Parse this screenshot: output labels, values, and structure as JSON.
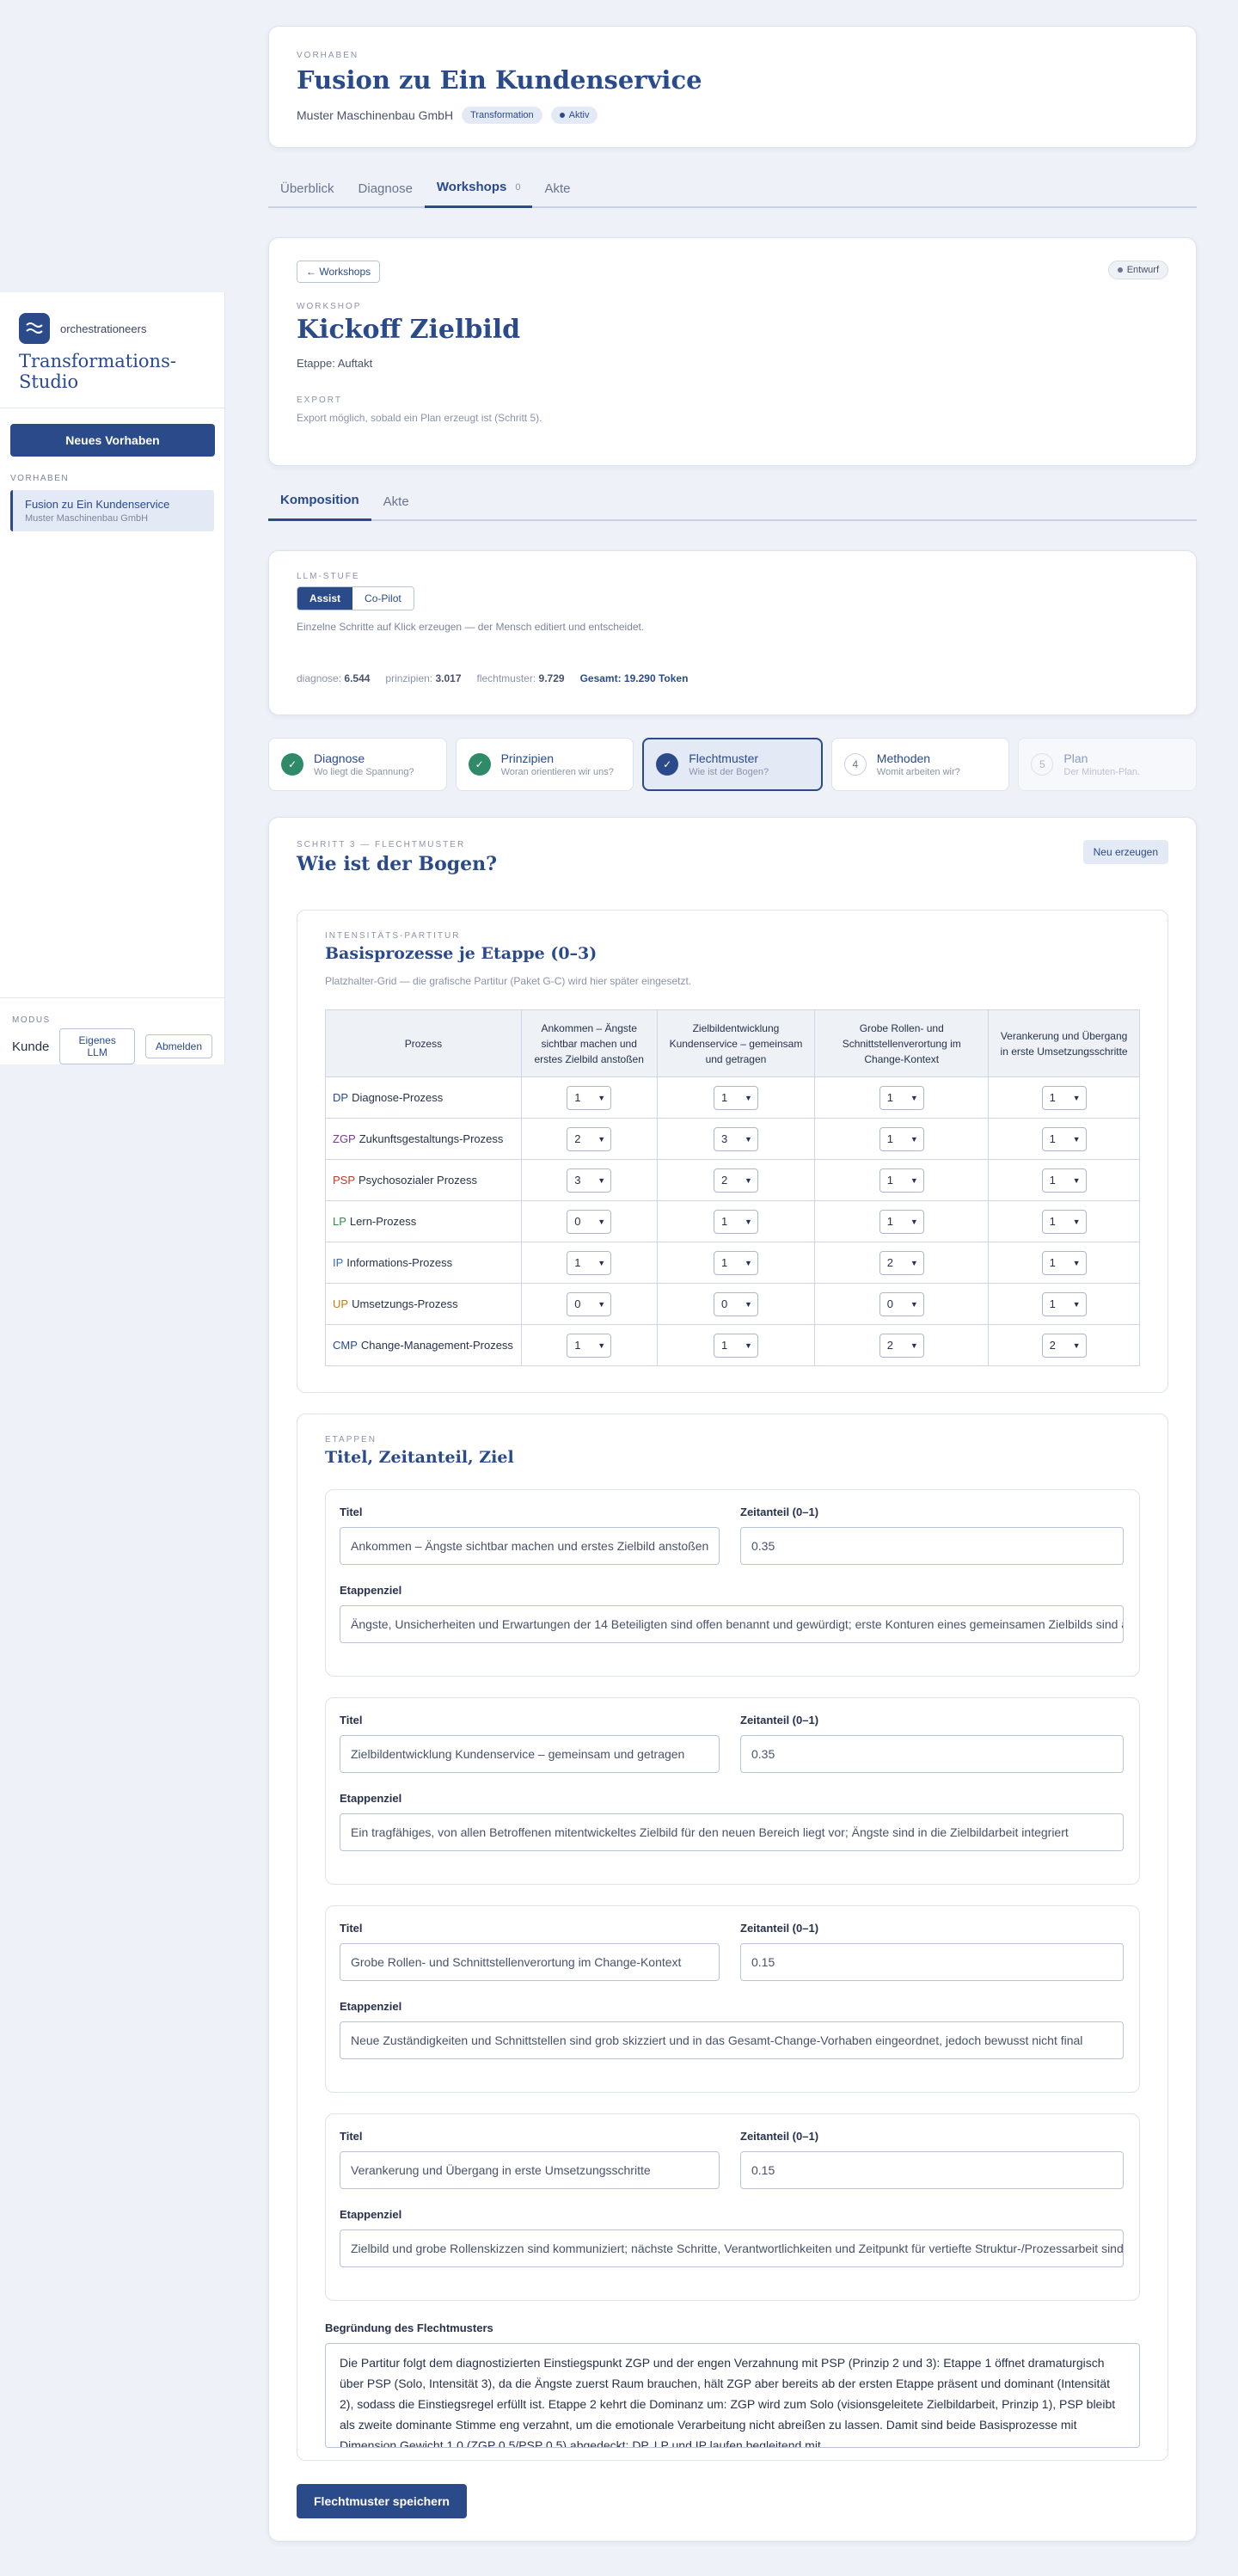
{
  "sidebar": {
    "brand": "orchestrationeers",
    "studio": "Transformations-Studio",
    "new_button": "Neues Vorhaben",
    "section_label": "VORHABEN",
    "project": {
      "title": "Fusion zu Ein Kundenservice",
      "subtitle": "Muster Maschinenbau GmbH"
    },
    "modus_label": "MODUS",
    "modus_value": "Kunde",
    "llm_button": "Eigenes LLM",
    "logout_button": "Abmelden"
  },
  "header": {
    "eyebrow": "VORHABEN",
    "title": "Fusion zu Ein Kundenservice",
    "company": "Muster Maschinenbau GmbH",
    "tag": "Transformation",
    "status": "Aktiv"
  },
  "main_tabs": [
    {
      "label": "Überblick"
    },
    {
      "label": "Diagnose"
    },
    {
      "label": "Workshops",
      "count": "0"
    },
    {
      "label": "Akte"
    }
  ],
  "workshop": {
    "back": "← Workshops",
    "status": "Entwurf",
    "eyebrow": "WORKSHOP",
    "title": "Kickoff Zielbild",
    "etappe": "Etappe: Auftakt",
    "export_label": "EXPORT",
    "export_text": "Export möglich, sobald ein Plan erzeugt ist (Schritt 5)."
  },
  "sub_tabs": [
    {
      "label": "Komposition"
    },
    {
      "label": "Akte"
    }
  ],
  "llm": {
    "eyebrow": "LLM-STUFE",
    "options": [
      "Assist",
      "Co-Pilot"
    ],
    "description": "Einzelne Schritte auf Klick erzeugen — der Mensch editiert und entscheidet.",
    "tokens": {
      "diagnose_label": "diagnose:",
      "diagnose": "6.544",
      "prinzipien_label": "prinzipien:",
      "prinzipien": "3.017",
      "flechtmuster_label": "flechtmuster:",
      "flechtmuster": "9.729",
      "total": "Gesamt: 19.290 Token"
    }
  },
  "steps": [
    {
      "icon": "✓",
      "title": "Diagnose",
      "sub": "Wo liegt die Spannung?"
    },
    {
      "icon": "✓",
      "title": "Prinzipien",
      "sub": "Woran orientieren wir uns?"
    },
    {
      "icon": "✓",
      "title": "Flechtmuster",
      "sub": "Wie ist der Bogen?"
    },
    {
      "icon": "4",
      "title": "Methoden",
      "sub": "Womit arbeiten wir?"
    },
    {
      "icon": "5",
      "title": "Plan",
      "sub": "Der Minuten-Plan."
    }
  ],
  "step3": {
    "eyebrow": "SCHRITT 3 — FLECHTMUSTER",
    "title": "Wie ist der Bogen?",
    "regen_button": "Neu erzeugen"
  },
  "partitur": {
    "eyebrow": "INTENSITÄTS-PARTITUR",
    "title": "Basisprozesse je Etappe (0–3)",
    "description": "Platzhalter-Grid — die grafische Partitur (Paket G-C) wird hier später eingesetzt.",
    "columns": [
      "Prozess",
      "Ankommen – Ängste sichtbar machen und erstes Zielbild anstoßen",
      "Zielbildentwicklung Kundenservice – gemeinsam und getragen",
      "Grobe Rollen- und Schnittstellenverortung im Change-Kontext",
      "Verankerung und Übergang in erste Umsetzungsschritte"
    ],
    "rows": [
      {
        "abbr": "DP",
        "color": "#2a4a8a",
        "name": "Diagnose-Prozess",
        "values": [
          "1",
          "1",
          "1",
          "1"
        ]
      },
      {
        "abbr": "ZGP",
        "color": "#7a3a8a",
        "name": "Zukunftsgestaltungs-Prozess",
        "values": [
          "2",
          "3",
          "1",
          "1"
        ]
      },
      {
        "abbr": "PSP",
        "color": "#c0392b",
        "name": "Psychosozialer Prozess",
        "values": [
          "3",
          "2",
          "1",
          "1"
        ]
      },
      {
        "abbr": "LP",
        "color": "#2f8a4a",
        "name": "Lern-Prozess",
        "values": [
          "0",
          "1",
          "1",
          "1"
        ]
      },
      {
        "abbr": "IP",
        "color": "#3a6ab0",
        "name": "Informations-Prozess",
        "values": [
          "1",
          "1",
          "2",
          "1"
        ]
      },
      {
        "abbr": "UP",
        "color": "#c07a1a",
        "name": "Umsetzungs-Prozess",
        "values": [
          "0",
          "0",
          "0",
          "1"
        ]
      },
      {
        "abbr": "CMP",
        "color": "#2a4a8a",
        "name": "Change-Management-Prozess",
        "values": [
          "1",
          "1",
          "2",
          "2"
        ]
      }
    ]
  },
  "etappen": {
    "eyebrow": "ETAPPEN",
    "title": "Titel, Zeitanteil, Ziel",
    "title_label": "Titel",
    "share_label": "Zeitanteil (0–1)",
    "goal_label": "Etappenziel",
    "items": [
      {
        "title": "Ankommen – Ängste sichtbar machen und erstes Zielbild anstoßen",
        "share": "0.35",
        "goal": "Ängste, Unsicherheiten und Erwartungen der 14 Beteiligten sind offen benannt und gewürdigt; erste Konturen eines gemeinsamen Zielbilds sind angestoßen"
      },
      {
        "title": "Zielbildentwicklung Kundenservice – gemeinsam und getragen",
        "share": "0.35",
        "goal": "Ein tragfähiges, von allen Betroffenen mitentwickeltes Zielbild für den neuen Bereich liegt vor; Ängste sind in die Zielbildarbeit integriert"
      },
      {
        "title": "Grobe Rollen- und Schnittstellenverortung im Change-Kontext",
        "share": "0.15",
        "goal": "Neue Zuständigkeiten und Schnittstellen sind grob skizziert und in das Gesamt-Change-Vorhaben eingeordnet, jedoch bewusst nicht final"
      },
      {
        "title": "Verankerung und Übergang in erste Umsetzungsschritte",
        "share": "0.15",
        "goal": "Zielbild und grobe Rollenskizzen sind kommuniziert; nächste Schritte, Verantwortlichkeiten und Zeitpunkt für vertiefte Struktur-/Prozessarbeit sind vereinbart"
      }
    ],
    "rationale_label": "Begründung des Flechtmusters",
    "rationale": "Die Partitur folgt dem diagnostizierten Einstiegspunkt ZGP und der engen Verzahnung mit PSP (Prinzip 2 und 3): Etappe 1 öffnet dramaturgisch über PSP (Solo, Intensität 3), da die Ängste zuerst Raum brauchen, hält ZGP aber bereits ab der ersten Etappe präsent und dominant (Intensität 2), sodass die Einstiegsregel erfüllt ist. Etappe 2 kehrt die Dominanz um: ZGP wird zum Solo (visionsgeleitete Zielbildarbeit, Prinzip 1), PSP bleibt als zweite dominante Stimme eng verzahnt, um die emotionale Verarbeitung nicht abreißen zu lassen. Damit sind beide Basisprozesse mit Dimension Gewicht 1.0 (ZGP 0.5/PSP 0.5) abgedeckt; DP, LP und IP laufen begleitend mit."
  },
  "save_button": "Flechtmuster speichern"
}
